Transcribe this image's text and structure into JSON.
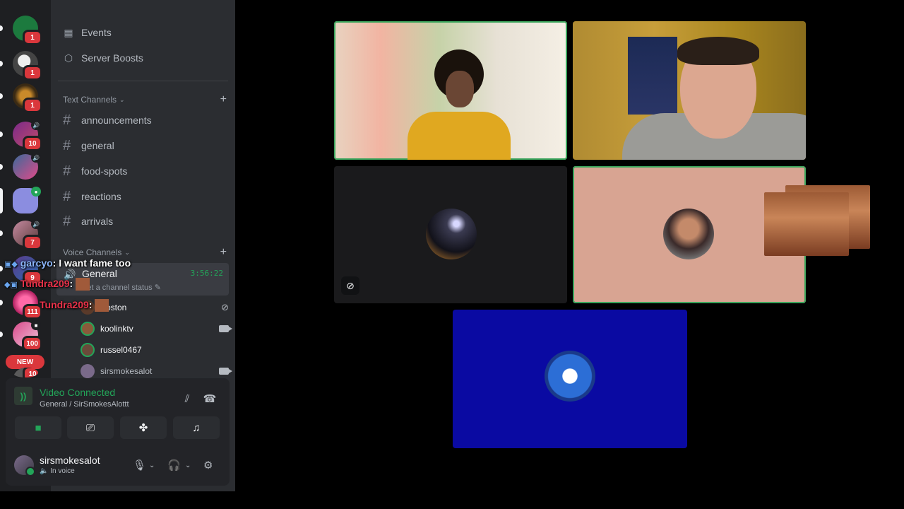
{
  "sidebar": {
    "top_items": [
      {
        "label": "Events",
        "icon": "calendar-icon"
      },
      {
        "label": "Server Boosts",
        "icon": "boost-icon"
      }
    ],
    "text_category": "Text Channels",
    "text_channels": [
      "announcements",
      "general",
      "food-spots",
      "reactions",
      "arrivals"
    ],
    "voice_category": "Voice Channels",
    "voice_channel": {
      "name": "General",
      "timer": "3:56:22",
      "status_placeholder": "Set a channel status"
    },
    "members": [
      {
        "name": "Boston",
        "state": "muted"
      },
      {
        "name": "koolinktv",
        "state": "video"
      },
      {
        "name": "russel0467",
        "state": "none"
      },
      {
        "name": "sirsmokesalot",
        "state": "video"
      }
    ]
  },
  "servers": [
    {
      "badge": "1",
      "color": "#1c7a3e"
    },
    {
      "badge": "1",
      "color": "#d9d9d9"
    },
    {
      "badge": "1",
      "color": "#6a4a18"
    },
    {
      "badge": "10",
      "color": "#7a2a8a"
    },
    {
      "badge": "",
      "color": "#3a6a9a"
    },
    {
      "badge": "",
      "color": "#8b8de0"
    },
    {
      "badge": "7",
      "color": "#c58aa0"
    },
    {
      "badge": "9",
      "color": "#5c3a8a"
    },
    {
      "badge": "111",
      "color": "#e04aa0"
    },
    {
      "badge": "100",
      "color": "#d84a8a"
    }
  ],
  "new_pill": "NEW",
  "rail_badge_bottom": "10",
  "overlay_chat": [
    {
      "user": "garcyo",
      "text": ": I want fame too",
      "color": "#8ab4f8"
    },
    {
      "user": "Tundra209",
      "text": ":",
      "color": "#e8324a"
    },
    {
      "user": "Tundra209",
      "text": ":",
      "color": "#e8324a"
    }
  ],
  "voice_panel": {
    "title": "Video Connected",
    "subtitle": "General / SirSmokesAlottt",
    "user_name": "sirsmokesalot",
    "user_status": "In voice"
  },
  "accent": {
    "green": "#23a559",
    "red": "#da373c"
  }
}
